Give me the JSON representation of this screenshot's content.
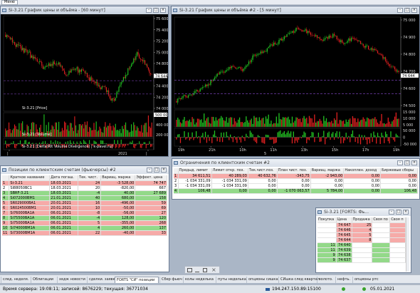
{
  "menu": {
    "button_label": "Меню"
  },
  "chart_left": {
    "title": "Si-3.21 График цены и объёма - [60 минут]",
    "price_ticks": [
      "75 600",
      "75 400",
      "75 200",
      "75 000",
      "74 800",
      "74 600",
      "74 400",
      "74 200",
      "74 000"
    ],
    "price_current": "74 644",
    "price_label": "Si-3.21 [Price]",
    "volume_ticks": [
      "600 000",
      "400 000",
      "200 000"
    ],
    "volume_current": "500 00",
    "volume_label": "Si-3.21 [Volume]",
    "ind_label": "Si-3.21 [Delta(RIt Volume Divergence) | k-pavel.ru]",
    "x_label": "2021",
    "x_ticks": [
      "|",
      "|"
    ]
  },
  "chart_right": {
    "title": "Si-3.21 График цены и объёма #2 - [5 минут]",
    "price_ticks": [
      "75 000",
      "74 900",
      "74 800",
      "74 700",
      "74 600",
      "74 500"
    ],
    "price_current": "74 644",
    "volume_ticks": [
      "15 000",
      "10 000",
      "5 000"
    ],
    "ind_ticks": [
      "50 000",
      "0",
      "-50 000"
    ],
    "x_ticks": [
      "19h",
      "21h",
      "10h",
      "11h",
      "13h",
      "15h",
      "17h",
      "19h"
    ],
    "x_label": "5"
  },
  "positions": {
    "title": "Позиции по клиентским счетам (фьючерсы) #2",
    "columns": [
      "",
      "Краткое название",
      "Дата погаш.",
      "Тек. чист.",
      "Вариац. маржа",
      "Эффект. цена"
    ],
    "rows": [
      {
        "n": "1",
        "name": "Si-3.21",
        "date": "18.03.2021",
        "cur": "24",
        "var": "-3 528,00",
        "eff": "74 747",
        "color": "red"
      },
      {
        "n": "2",
        "name": "SI88050BC1",
        "date": "18.03.2021",
        "cur": "20",
        "var": "-820,00",
        "eff": "667",
        "color": "white"
      },
      {
        "n": "3",
        "name": "SBRF-3.21",
        "date": "18.03.2021",
        "cur": "-4",
        "var": "40,00",
        "eff": "27 689",
        "color": "green"
      },
      {
        "n": "4",
        "name": "Si072000BM1",
        "date": "21.01.2021",
        "cur": "40",
        "var": "680,00",
        "eff": "158",
        "color": "green"
      },
      {
        "n": "5",
        "name": "SR029000BA1",
        "date": "20.01.2021",
        "cur": "16",
        "var": "-496,00",
        "eff": "59",
        "color": "red"
      },
      {
        "n": "6",
        "name": "SR024500BM1",
        "date": "20.01.2021",
        "cur": "10",
        "var": "-50,00",
        "eff": "69",
        "color": "red"
      },
      {
        "n": "7",
        "name": "Si76000BA1A",
        "date": "06.01.2021",
        "cur": "-8",
        "var": "-56,00",
        "eff": "27",
        "color": "red"
      },
      {
        "n": "8",
        "name": "Si75500BA1A",
        "date": "06.01.2021",
        "cur": "-4",
        "var": "128,00",
        "eff": "120",
        "color": "green"
      },
      {
        "n": "9",
        "name": "Si75000BA1A",
        "date": "06.01.2021",
        "cur": "5",
        "var": "-355,00",
        "eff": "268",
        "color": "red"
      },
      {
        "n": "10",
        "name": "Si74000BM1A",
        "date": "06.01.2021",
        "cur": "4",
        "var": "260,00",
        "eff": "137",
        "color": "green"
      },
      {
        "n": "11",
        "name": "Si73000BM1A",
        "date": "06.01.2021",
        "cur": "22",
        "var": "-40,00",
        "eff": "33",
        "color": "red"
      }
    ]
  },
  "limits": {
    "title": "Ограничения по клиентским счетам #2",
    "columns": [
      "",
      "Предыд. лимит",
      "Лимит откр. поз.",
      "Тек.чист.поз.",
      "План чист. поз.",
      "Вариац. маржа",
      "Накоплен. доход",
      "Биржевые сборы"
    ],
    "rows": [
      {
        "n": "1",
        "prev": "34 611,51",
        "open": "40 289,03",
        "cur": "40 632,76",
        "plan": "-343,75",
        "var": "-2 943,00",
        "acc": "0,00",
        "fee": "0,00",
        "color": "red"
      },
      {
        "n": "2",
        "prev": "-1 034 331,09",
        "open": "-1 034 331,09",
        "cur": "0,00",
        "plan": "0,00",
        "var": "0,00",
        "acc": "0,00",
        "fee": "0,00",
        "color": "white"
      },
      {
        "n": "3",
        "prev": "-1 034 331,09",
        "open": "-1 034 331,09",
        "cur": "0,00",
        "plan": "0,00",
        "var": "0,00",
        "acc": "0,00",
        "fee": "0,00",
        "color": "white"
      },
      {
        "n": "4",
        "prev": "106,48",
        "open": "0,00",
        "cur": "0,00",
        "plan": "-1 070 063,57",
        "var": "5 784,00",
        "acc": "0,00",
        "fee": "106,48",
        "color": "green"
      }
    ]
  },
  "orderbook": {
    "title": "Si-3.21 [FORTS: Фь...",
    "columns": [
      "Покупка",
      "Цена",
      "Продажа",
      "Своя по",
      "Своя п"
    ],
    "rows": [
      {
        "buy": "",
        "price": "74 647",
        "sell": "25",
        "side": "ask"
      },
      {
        "buy": "",
        "price": "74 646",
        "sell": "4",
        "side": "ask"
      },
      {
        "buy": "",
        "price": "74 645",
        "sell": "5",
        "side": "ask"
      },
      {
        "buy": "",
        "price": "74 644",
        "sell": "8",
        "side": "ask"
      },
      {
        "buy": "11",
        "price": "74 640",
        "sell": "",
        "side": "bid"
      },
      {
        "buy": "11",
        "price": "74 639",
        "sell": "",
        "side": "bid"
      },
      {
        "buy": "9",
        "price": "74 638",
        "sell": "",
        "side": "bid"
      },
      {
        "buy": "9",
        "price": "74 637",
        "sell": "",
        "side": "bid"
      }
    ]
  },
  "tabs": [
    "след. неделя.",
    "Облигации",
    "хедж новости",
    "сделки. заявки",
    "FORTS \"СИ\" позиции",
    "Сбер фьюч",
    "колы неделька",
    "путы неделька",
    "опционы сишка",
    "СИшка след квартал",
    "золото.",
    "нефть.",
    "опционы ртс"
  ],
  "active_tab": 4,
  "status": {
    "server_time": "Время сервера: 19:08:11; записей: 8676229; текущая: 36771034",
    "connection": "194.247.150.89:15100",
    "date": "05.01.2021"
  },
  "colors": {
    "bull": "#22c322",
    "bear": "#e02020",
    "row_red": "#f6aaa8",
    "row_green": "#93d989"
  }
}
